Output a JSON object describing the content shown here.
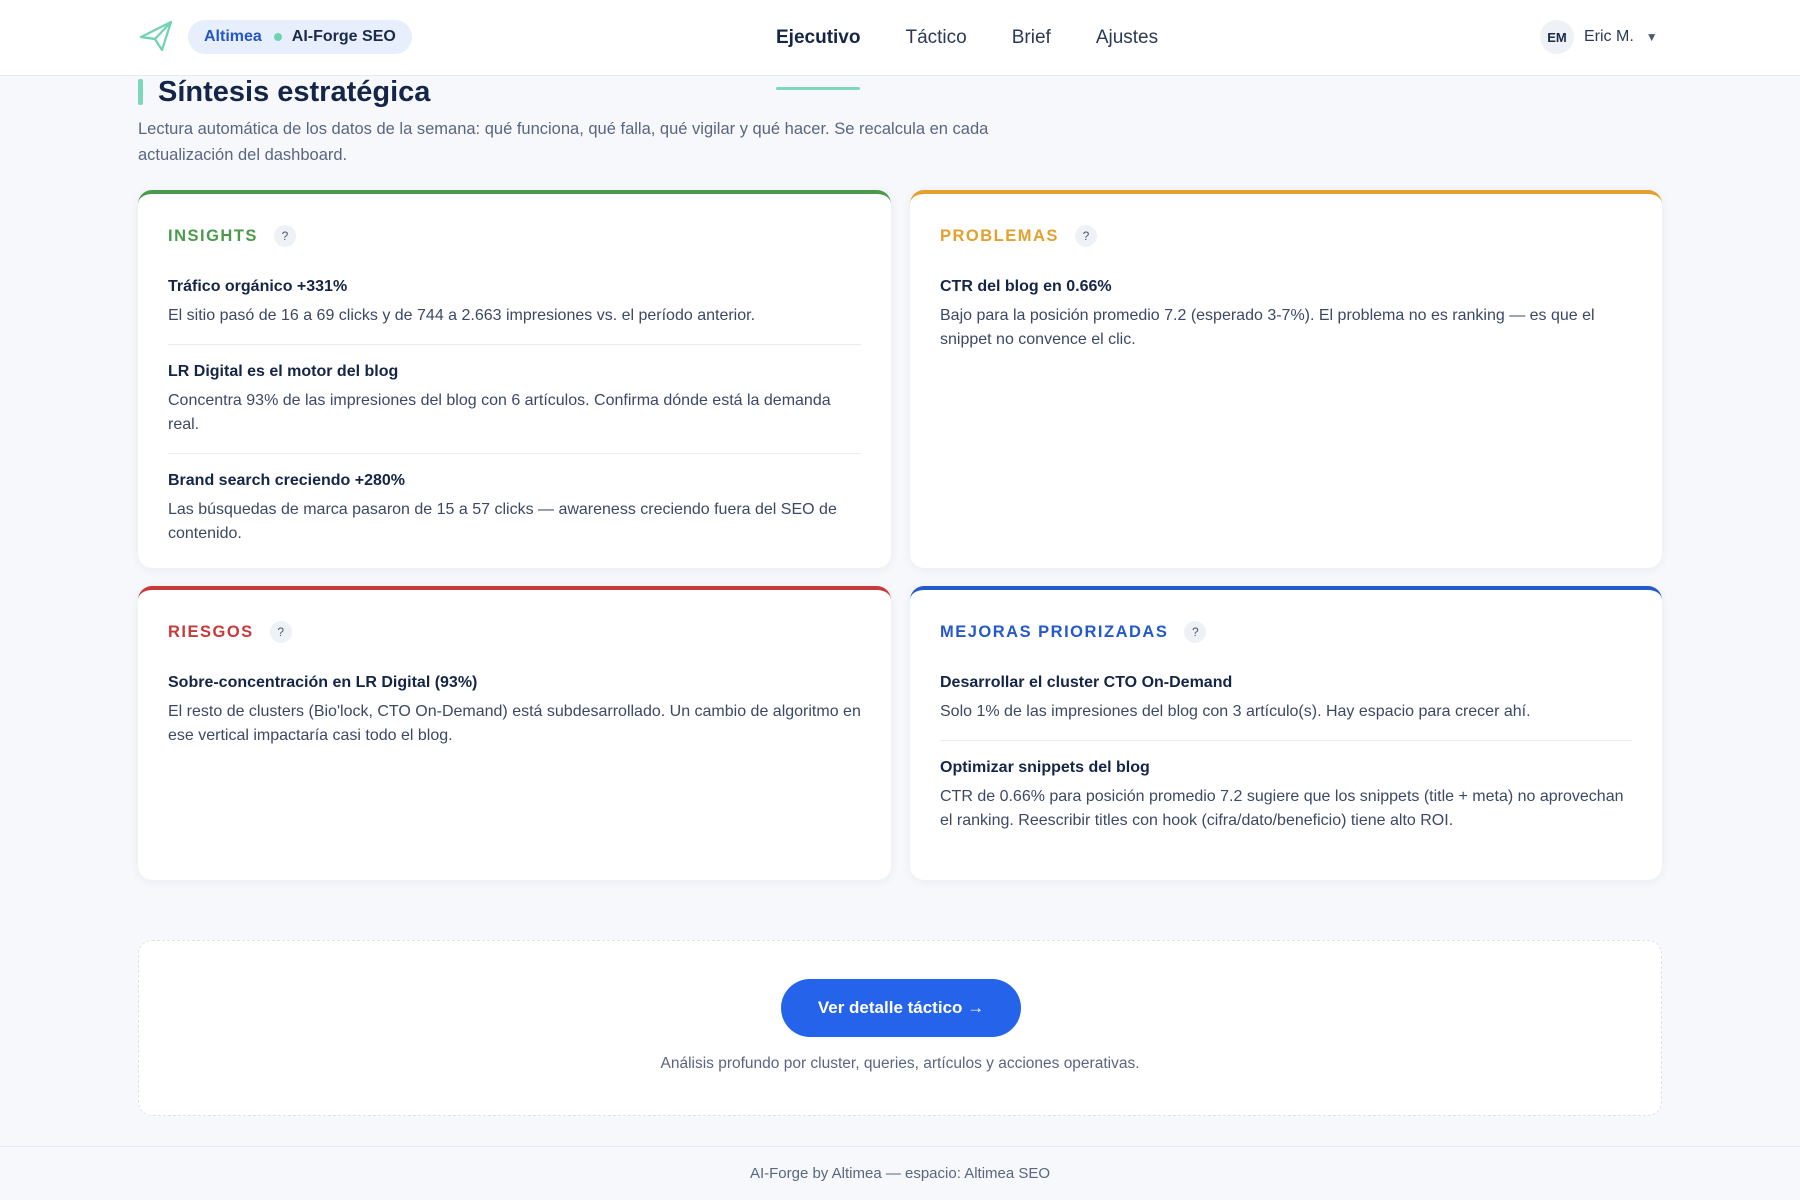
{
  "header": {
    "org": "Altimea",
    "product": "AI-Forge SEO",
    "nav": [
      "Ejecutivo",
      "Táctico",
      "Brief",
      "Ajustes"
    ],
    "active_nav": "Ejecutivo",
    "user_initials": "EM",
    "user_name": "Eric M."
  },
  "page": {
    "title": "Síntesis estratégica",
    "subtitle": "Lectura automática de los datos de la semana: qué funciona, qué falla, qué vigilar y qué hacer. Se recalcula en cada actualización del dashboard."
  },
  "colors": {
    "insights": "#4a9a4c",
    "problemas": "#e3a02d",
    "riesgos": "#c8393a",
    "mejoras": "#2459c9"
  },
  "cards": {
    "insights": {
      "label": "INSIGHTS",
      "help": "?",
      "items": [
        {
          "title": "Tráfico orgánico +331%",
          "text": "El sitio pasó de 16 a 69 clicks y de 744 a 2.663 impresiones vs. el período anterior."
        },
        {
          "title": "LR Digital es el motor del blog",
          "text": "Concentra 93% de las impresiones del blog con 6 artículos. Confirma dónde está la demanda real."
        },
        {
          "title": "Brand search creciendo +280%",
          "text": "Las búsquedas de marca pasaron de 15 a 57 clicks — awareness creciendo fuera del SEO de contenido."
        }
      ]
    },
    "problemas": {
      "label": "PROBLEMAS",
      "help": "?",
      "items": [
        {
          "title": "CTR del blog en 0.66%",
          "text": "Bajo para la posición promedio 7.2 (esperado 3-7%). El problema no es ranking — es que el snippet no convence el clic."
        }
      ]
    },
    "riesgos": {
      "label": "RIESGOS",
      "help": "?",
      "items": [
        {
          "title": "Sobre-concentración en LR Digital (93%)",
          "text": "El resto de clusters (Bio'lock, CTO On-Demand) está subdesarrollado. Un cambio de algoritmo en ese vertical impactaría casi todo el blog."
        }
      ]
    },
    "mejoras": {
      "label": "MEJORAS PRIORIZADAS",
      "help": "?",
      "items": [
        {
          "title": "Desarrollar el cluster CTO On-Demand",
          "text": "Solo 1% de las impresiones del blog con 3 artículo(s). Hay espacio para crecer ahí."
        },
        {
          "title": "Optimizar snippets del blog",
          "text": "CTR de 0.66% para posición promedio 7.2 sugiere que los snippets (title + meta) no aprovechan el ranking. Reescribir titles con hook (cifra/dato/beneficio) tiene alto ROI."
        }
      ]
    }
  },
  "cta": {
    "button": "Ver detalle táctico →",
    "note": "Análisis profundo por cluster, queries, artículos y acciones operativas."
  },
  "footer": {
    "text": "AI-Forge by Altimea — espacio: Altimea SEO"
  }
}
